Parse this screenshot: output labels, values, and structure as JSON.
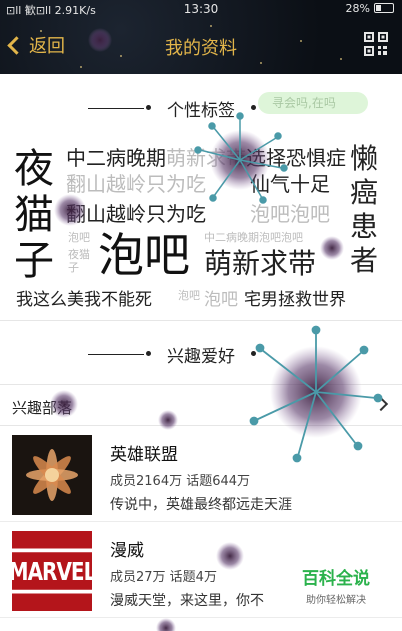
{
  "status_bar": {
    "signal_text": "⊡ll 歓⊡ll 2.91K/s",
    "time": "13:30",
    "battery": "28%"
  },
  "header": {
    "back_label": "返回",
    "title": "我的资料",
    "qr_icon": "qr-code-icon",
    "accent_color": "#e2b54a",
    "background_color": "#0b0f15"
  },
  "tags_section": {
    "title": "个性标签",
    "bubble_text": "寻会吗,在吗",
    "tags": [
      {
        "text": "夜猫子",
        "style": "big-vertical"
      },
      {
        "text": "中二病晚期",
        "style": "m"
      },
      {
        "text": "萌新求带",
        "style": "m-gray"
      },
      {
        "text": "选择恐惧症",
        "style": "m"
      },
      {
        "text": "懒癌患者",
        "style": "big-vertical"
      },
      {
        "text": "翻山越岭只为吃",
        "style": "m-gray"
      },
      {
        "text": "仙气十足",
        "style": "m"
      },
      {
        "text": "翻山越岭只为吃",
        "style": "m"
      },
      {
        "text": "泡吧泡吧",
        "style": "m-gray"
      },
      {
        "text": "泡吧",
        "style": "huge"
      },
      {
        "text": "中二病晚期泡吧泡吧",
        "style": "xs-gray"
      },
      {
        "text": "萌新求带",
        "style": "l"
      },
      {
        "text": "泡吧",
        "style": "xs-gray"
      },
      {
        "text": "夜猫子",
        "style": "xs-gray"
      },
      {
        "text": "我这么美我不能死",
        "style": "s"
      },
      {
        "text": "泡吧",
        "style": "xs-gray"
      },
      {
        "text": "泡吧",
        "style": "s-gray"
      },
      {
        "text": "宅男拯救世界",
        "style": "s"
      }
    ]
  },
  "interests_section": {
    "title": "兴趣爱好",
    "tribe_label": "兴趣部落",
    "groups": [
      {
        "name": "英雄联盟",
        "meta": "成员2164万 话题644万",
        "desc": "传说中，英雄最终都远走天涯",
        "thumb": "flower-image"
      },
      {
        "name": "漫威",
        "meta": "成员27万 话题4万",
        "desc": "漫威天堂，来这里，你不",
        "thumb": "marvel-logo",
        "thumb_text": "MARVEL"
      }
    ]
  },
  "watermark": {
    "title": "百科全说",
    "subtitle": "助你轻松解决"
  }
}
